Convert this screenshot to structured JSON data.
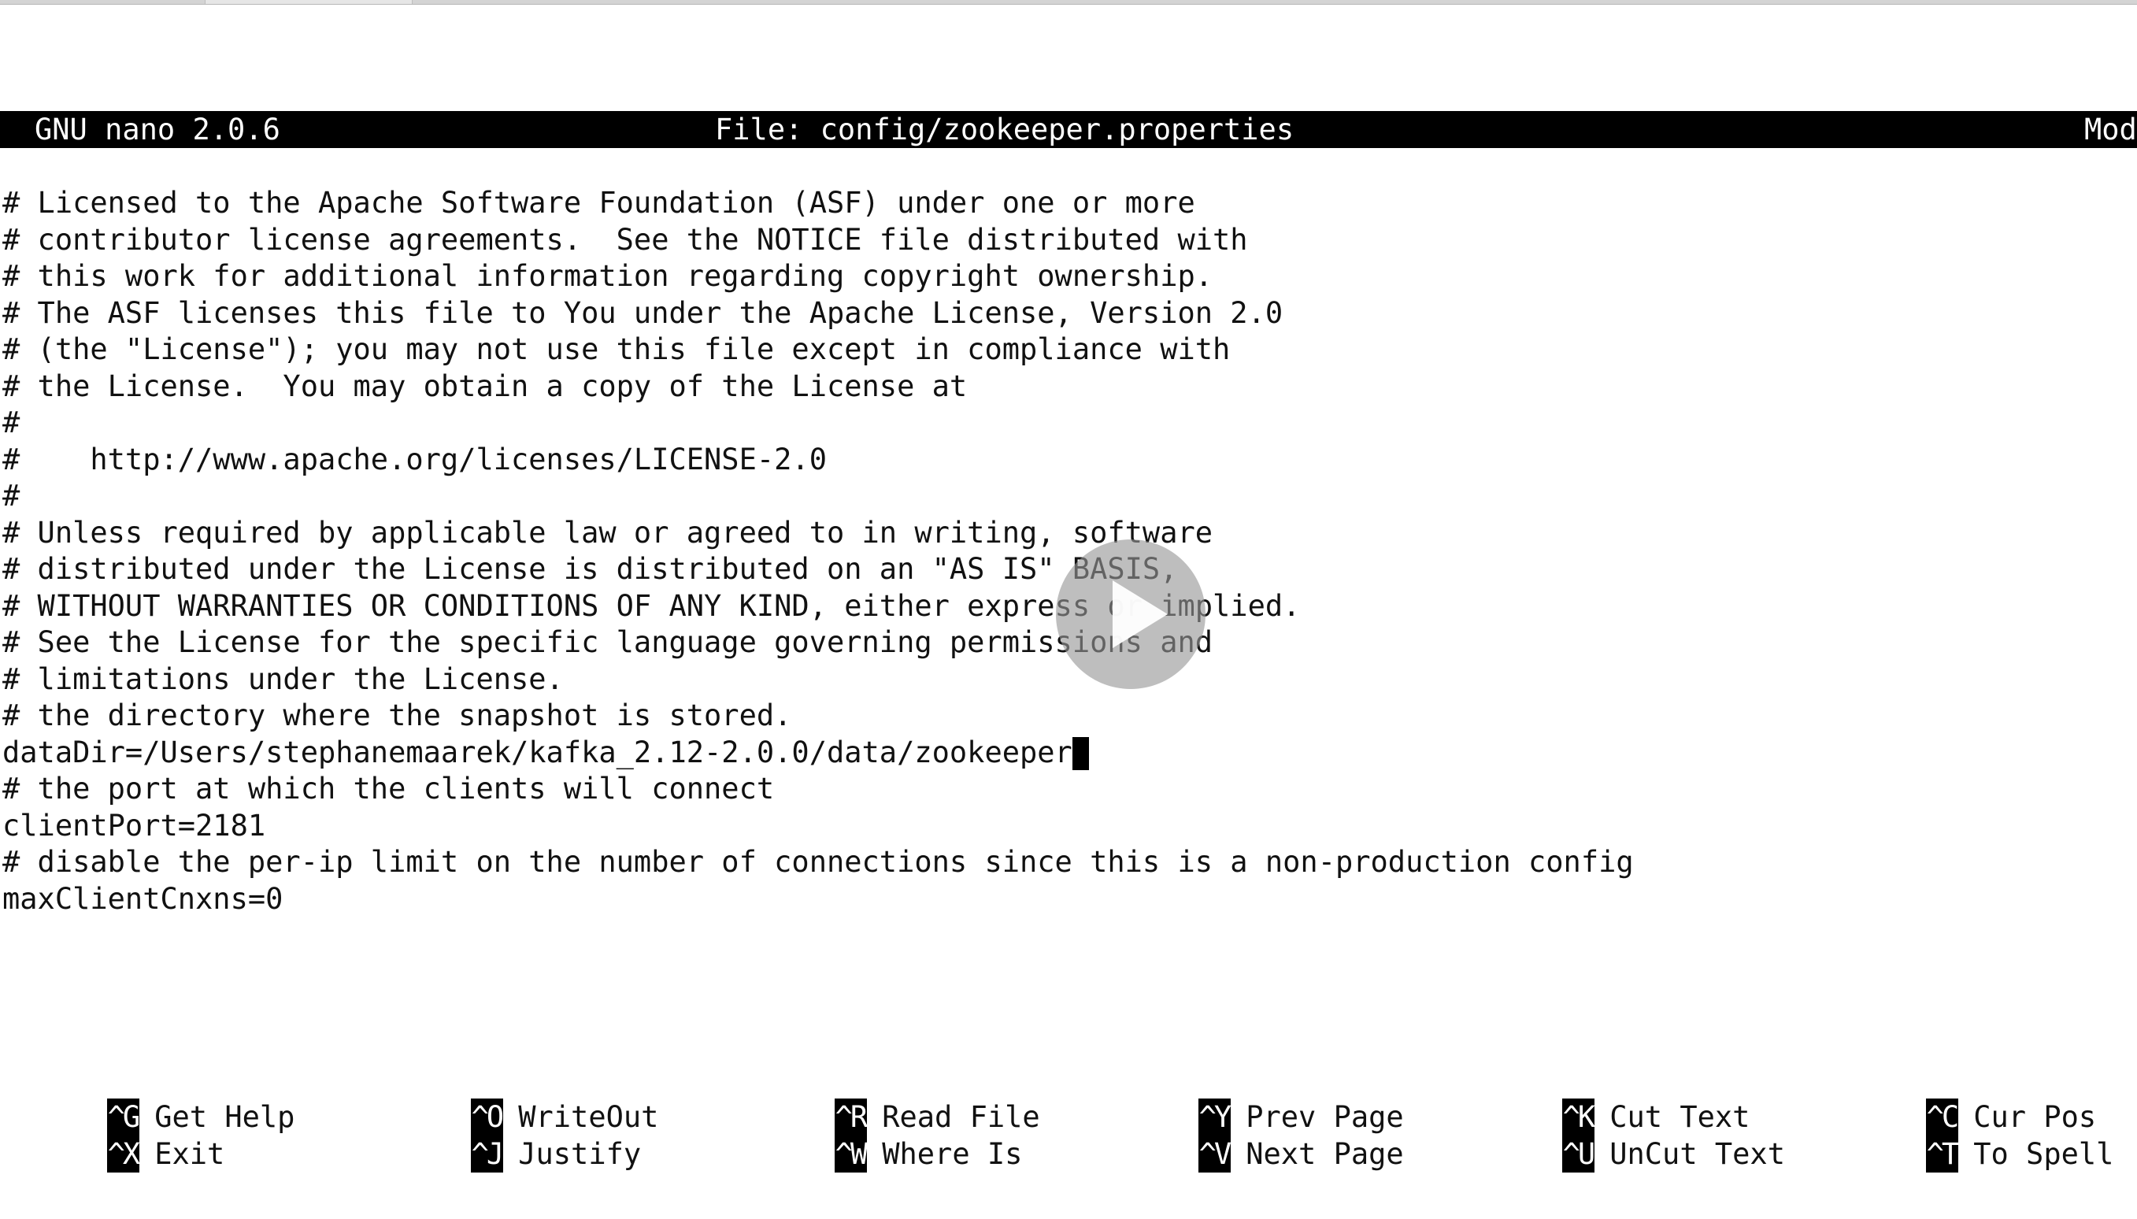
{
  "titlebar": {
    "app_name": "GNU nano 2.0.6",
    "file_name": "File: config/zookeeper.properties",
    "status": "Mod"
  },
  "editor": {
    "lines": [
      "# Licensed to the Apache Software Foundation (ASF) under one or more",
      "# contributor license agreements.  See the NOTICE file distributed with",
      "# this work for additional information regarding copyright ownership.",
      "# The ASF licenses this file to You under the Apache License, Version 2.0",
      "# (the \"License\"); you may not use this file except in compliance with",
      "# the License.  You may obtain a copy of the License at",
      "#",
      "#    http://www.apache.org/licenses/LICENSE-2.0",
      "#",
      "# Unless required by applicable law or agreed to in writing, software",
      "# distributed under the License is distributed on an \"AS IS\" BASIS,",
      "# WITHOUT WARRANTIES OR CONDITIONS OF ANY KIND, either express or implied.",
      "# See the License for the specific language governing permissions and",
      "# limitations under the License.",
      "# the directory where the snapshot is stored.",
      "dataDir=/Users/stephanemaarek/kafka_2.12-2.0.0/data/zookeeper",
      "# the port at which the clients will connect",
      "clientPort=2181",
      "# disable the per-ip limit on the number of connections since this is a non-production config",
      "maxClientCnxns=0"
    ]
  },
  "shortcuts": {
    "row1": [
      {
        "key": "^G",
        "label": "Get Help"
      },
      {
        "key": "^O",
        "label": "WriteOut"
      },
      {
        "key": "^R",
        "label": "Read File"
      },
      {
        "key": "^Y",
        "label": "Prev Page"
      },
      {
        "key": "^K",
        "label": "Cut Text"
      },
      {
        "key": "^C",
        "label": "Cur Pos"
      }
    ],
    "row2": [
      {
        "key": "^X",
        "label": "Exit"
      },
      {
        "key": "^J",
        "label": "Justify"
      },
      {
        "key": "^W",
        "label": "Where Is"
      },
      {
        "key": "^V",
        "label": "Next Page"
      },
      {
        "key": "^U",
        "label": "UnCut Text"
      },
      {
        "key": "^T",
        "label": "To Spell"
      }
    ]
  },
  "overlay": {
    "icon": "play-icon",
    "color": "#969696"
  }
}
